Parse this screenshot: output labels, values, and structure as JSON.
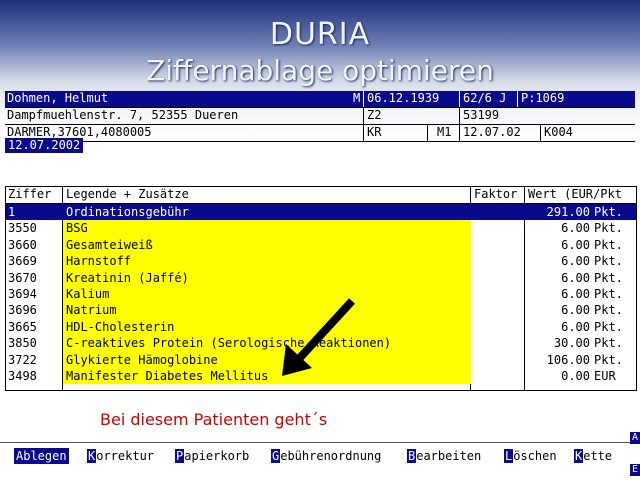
{
  "slide": {
    "title": "DURIA",
    "subtitle": "Ziffernablage optimieren"
  },
  "patient": {
    "name": "Dohmen, Helmut",
    "sex": "M",
    "birthdate": "06.12.1939",
    "age": "62/6 J",
    "patient_no": "P:1069",
    "address": "Dampfmuehlenstr. 7, 52355 Dueren",
    "zone": "Z2",
    "zip": "53199",
    "insurance": "DARMER,37601,4080005",
    "insurance_type": "KR",
    "status": "M1",
    "card_date": "12.07.02",
    "card_code": "K004",
    "current_date": "12.07.2002"
  },
  "table": {
    "headers": {
      "code": "Ziffer",
      "legend": "Legende + Zusätze",
      "factor": "Faktor",
      "value": "Wert (EUR/Pkt"
    },
    "rows": [
      {
        "code": "1",
        "legend": "Ordinationsgebühr",
        "value": "291.00",
        "unit": "Pkt."
      },
      {
        "code": "3550",
        "legend": "BSG",
        "value": "6.00",
        "unit": "Pkt."
      },
      {
        "code": "3660",
        "legend": "Gesamteiweiß",
        "value": "6.00",
        "unit": "Pkt."
      },
      {
        "code": "3669",
        "legend": "Harnstoff",
        "value": "6.00",
        "unit": "Pkt."
      },
      {
        "code": "3670",
        "legend": "Kreatinin (Jaffé)",
        "value": "6.00",
        "unit": "Pkt."
      },
      {
        "code": "3694",
        "legend": "Kalium",
        "value": "6.00",
        "unit": "Pkt."
      },
      {
        "code": "3696",
        "legend": "Natrium",
        "value": "6.00",
        "unit": "Pkt."
      },
      {
        "code": "3665",
        "legend": "HDL-Cholesterin",
        "value": "6.00",
        "unit": "Pkt."
      },
      {
        "code": "3850",
        "legend": "C-reaktives Protein (Serologische Reaktionen)",
        "value": "30.00",
        "unit": "Pkt."
      },
      {
        "code": "3722",
        "legend": "Glykierte Hämoglobine",
        "value": "106.00",
        "unit": "Pkt."
      },
      {
        "code": "3498",
        "legend": "Manifester Diabetes Mellitus",
        "value": "0.00",
        "unit": "EUR"
      }
    ]
  },
  "message": "Bei diesem Patienten geht´s",
  "menu": [
    {
      "hotkey": "A",
      "rest": "blegen"
    },
    {
      "hotkey": "K",
      "rest": "orrektur"
    },
    {
      "hotkey": "P",
      "rest": "apierkorb"
    },
    {
      "hotkey": "G",
      "rest": "ebührenordnung"
    },
    {
      "hotkey": "B",
      "rest": "earbeiten"
    },
    {
      "hotkey": "L",
      "rest": "öschen"
    },
    {
      "hotkey": "K",
      "rest": "ette"
    }
  ],
  "side_markers": {
    "top": "A",
    "bottom": "E"
  },
  "colors": {
    "highlight": "#0a0a8c",
    "marker": "#ffff00",
    "message": "#d00000"
  }
}
